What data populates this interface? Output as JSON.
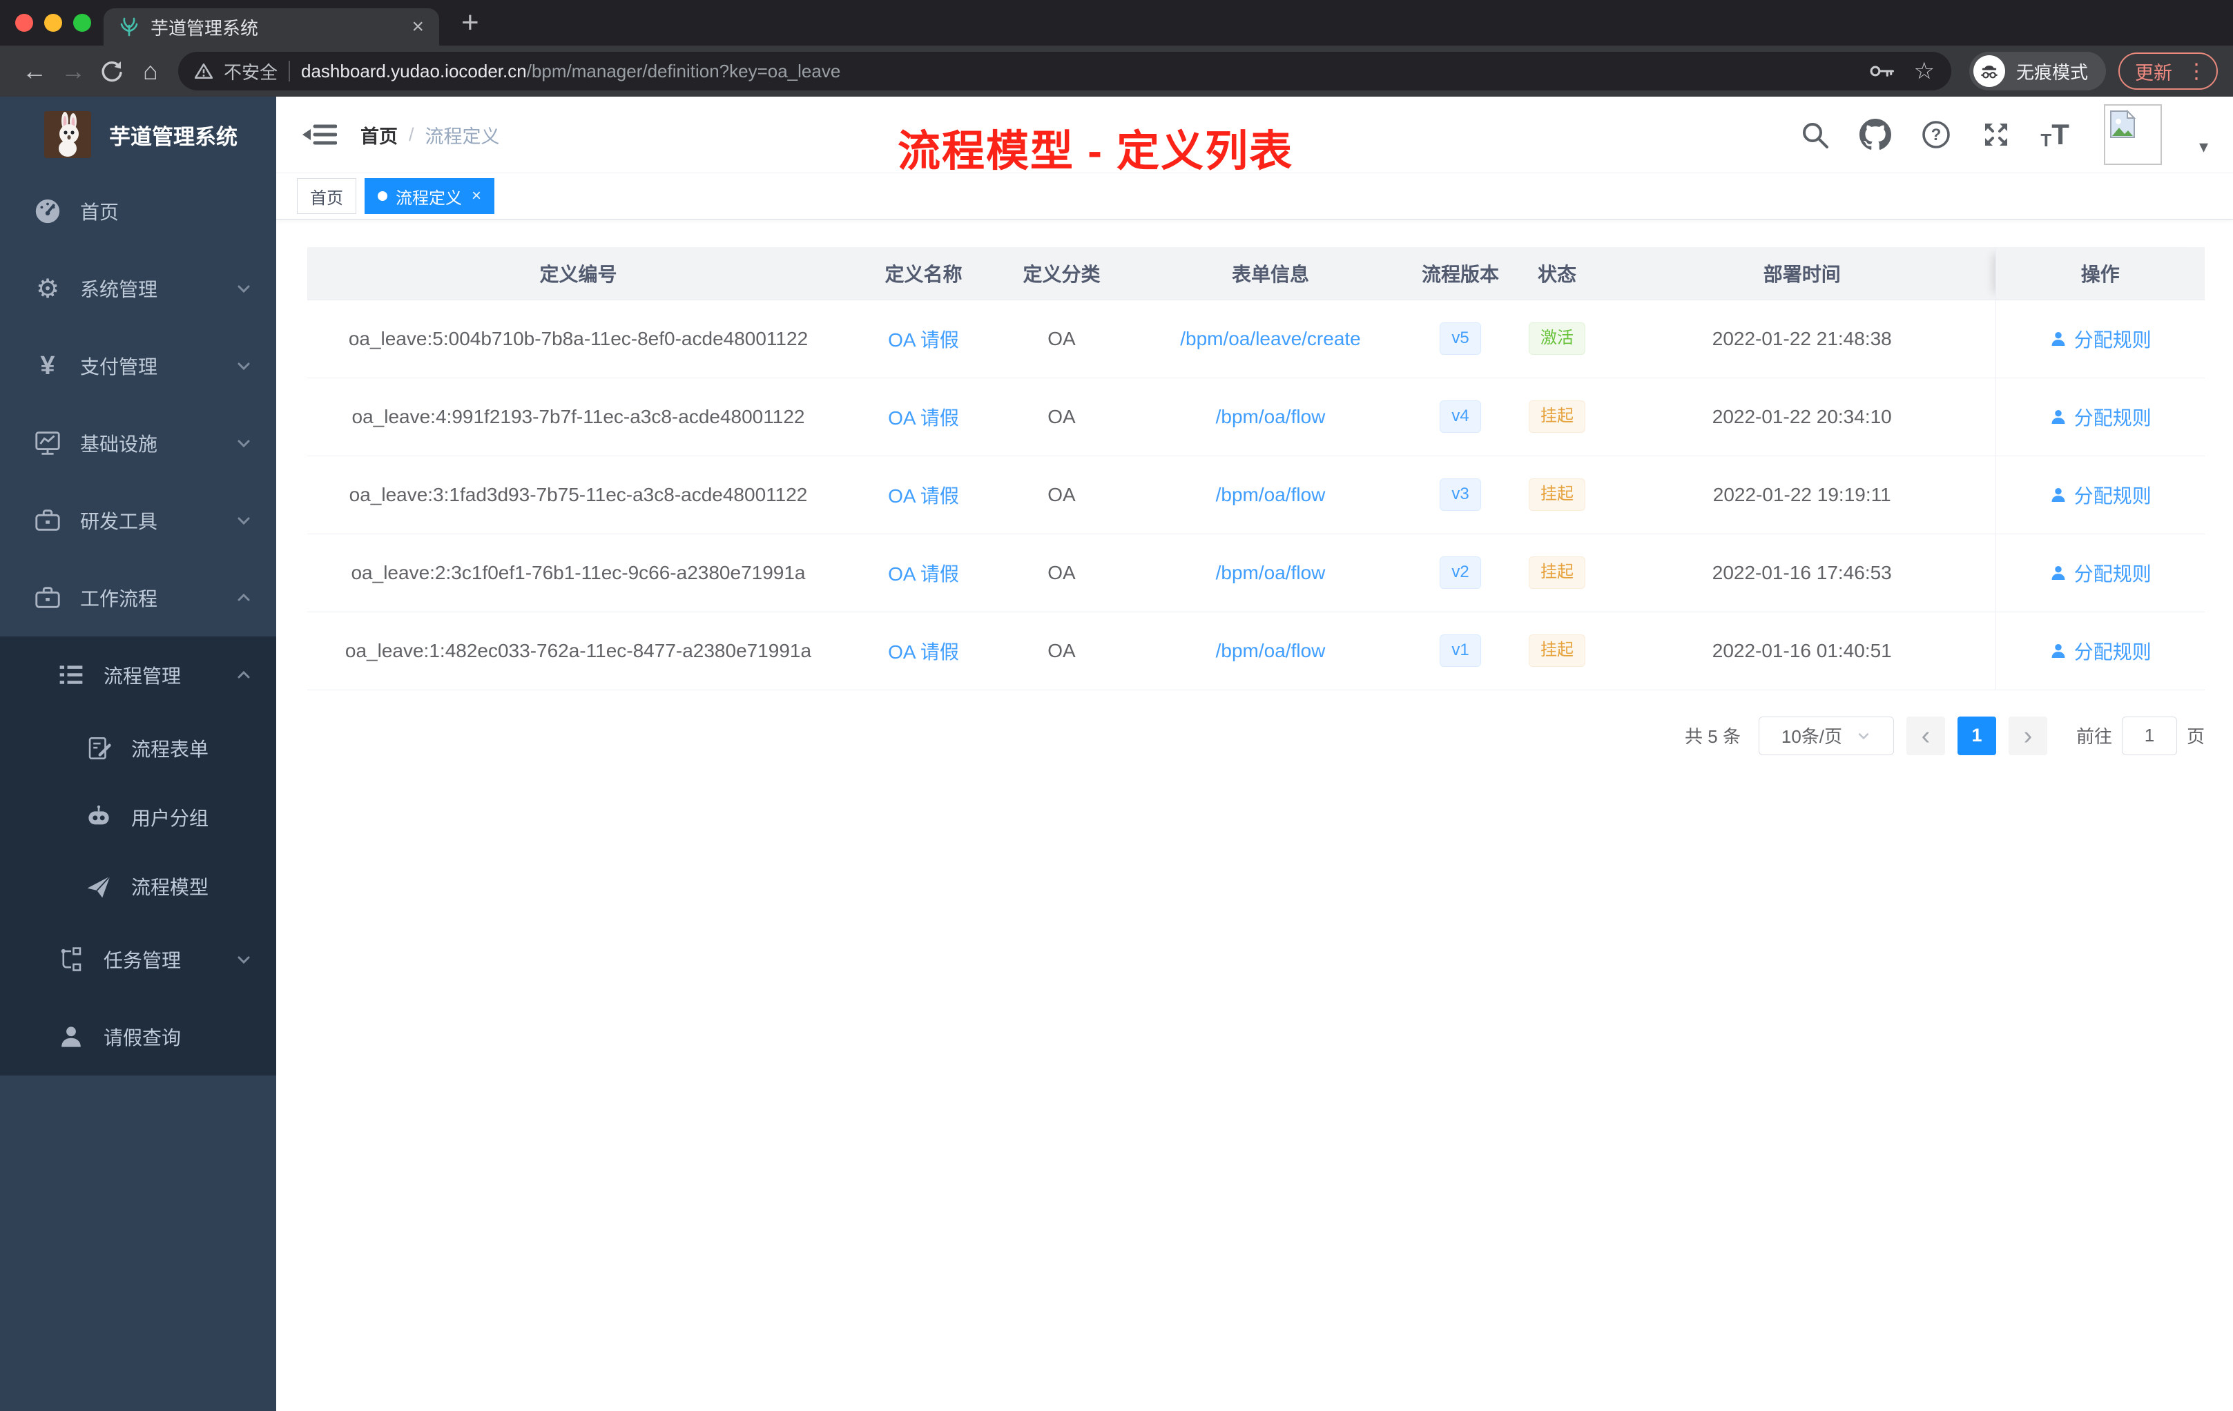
{
  "colors": {
    "accent": "#1890ff",
    "link": "#409eff",
    "success": "#67c23a",
    "warning": "#e6a23c",
    "annotation_red": "#fb2318",
    "sidebar_bg": "#304156",
    "sidebar_submenu_bg": "#1f2d3d"
  },
  "browser": {
    "tab_title": "芋道管理系统",
    "security_label": "不安全",
    "url_host": "dashboard.yudao.iocoder.cn",
    "url_path": "/bpm/manager/definition?key=oa_leave",
    "incognito_label": "无痕模式",
    "update_label": "更新"
  },
  "icons": {
    "tab_close": "×",
    "new_tab": "+",
    "nav_back": "←",
    "nav_forward": "→",
    "nav_home": "⌂",
    "bookmark_star": "☆",
    "kebab": "⋮",
    "gear": "⚙",
    "yen": "¥",
    "breadcrumb_separator": "/",
    "tag_close": "×",
    "avatar_caret": "▾",
    "pager_prev": "‹",
    "pager_next": "›",
    "t_small": "T",
    "t_big": "T"
  },
  "sidebar": {
    "app_title": "芋道管理系统",
    "items": [
      {
        "label": "首页"
      },
      {
        "label": "系统管理"
      },
      {
        "label": "支付管理"
      },
      {
        "label": "基础设施"
      },
      {
        "label": "研发工具"
      },
      {
        "label": "工作流程"
      },
      {
        "label": "流程管理"
      },
      {
        "label": "流程表单"
      },
      {
        "label": "用户分组"
      },
      {
        "label": "流程模型"
      },
      {
        "label": "任务管理"
      },
      {
        "label": "请假查询"
      }
    ]
  },
  "header": {
    "breadcrumb": {
      "home": "首页",
      "current": "流程定义"
    },
    "annotation": "流程模型 - 定义列表"
  },
  "tagsbar": {
    "tags": [
      {
        "label": "首页"
      },
      {
        "label": "流程定义"
      }
    ]
  },
  "table": {
    "columns": [
      "定义编号",
      "定义名称",
      "定义分类",
      "表单信息",
      "流程版本",
      "状态",
      "部署时间",
      "操作"
    ],
    "rows": [
      {
        "id": "oa_leave:5:004b710b-7b8a-11ec-8ef0-acde48001122",
        "name": "OA 请假",
        "category": "OA",
        "form": "/bpm/oa/leave/create",
        "version": "v5",
        "status": "激活",
        "time": "2022-01-22 21:48:38",
        "action": "分配规则"
      },
      {
        "id": "oa_leave:4:991f2193-7b7f-11ec-a3c8-acde48001122",
        "name": "OA 请假",
        "category": "OA",
        "form": "/bpm/oa/flow",
        "version": "v4",
        "status": "挂起",
        "time": "2022-01-22 20:34:10",
        "action": "分配规则"
      },
      {
        "id": "oa_leave:3:1fad3d93-7b75-11ec-a3c8-acde48001122",
        "name": "OA 请假",
        "category": "OA",
        "form": "/bpm/oa/flow",
        "version": "v3",
        "status": "挂起",
        "time": "2022-01-22 19:19:11",
        "action": "分配规则"
      },
      {
        "id": "oa_leave:2:3c1f0ef1-76b1-11ec-9c66-a2380e71991a",
        "name": "OA 请假",
        "category": "OA",
        "form": "/bpm/oa/flow",
        "version": "v2",
        "status": "挂起",
        "time": "2022-01-16 17:46:53",
        "action": "分配规则"
      },
      {
        "id": "oa_leave:1:482ec033-762a-11ec-8477-a2380e71991a",
        "name": "OA 请假",
        "category": "OA",
        "form": "/bpm/oa/flow",
        "version": "v1",
        "status": "挂起",
        "time": "2022-01-16 01:40:51",
        "action": "分配规则"
      }
    ]
  },
  "pagination": {
    "total": "共 5 条",
    "page_size": "10条/页",
    "current_page": "1",
    "jump_prefix": "前往",
    "jump_value": "1",
    "jump_suffix": "页"
  }
}
